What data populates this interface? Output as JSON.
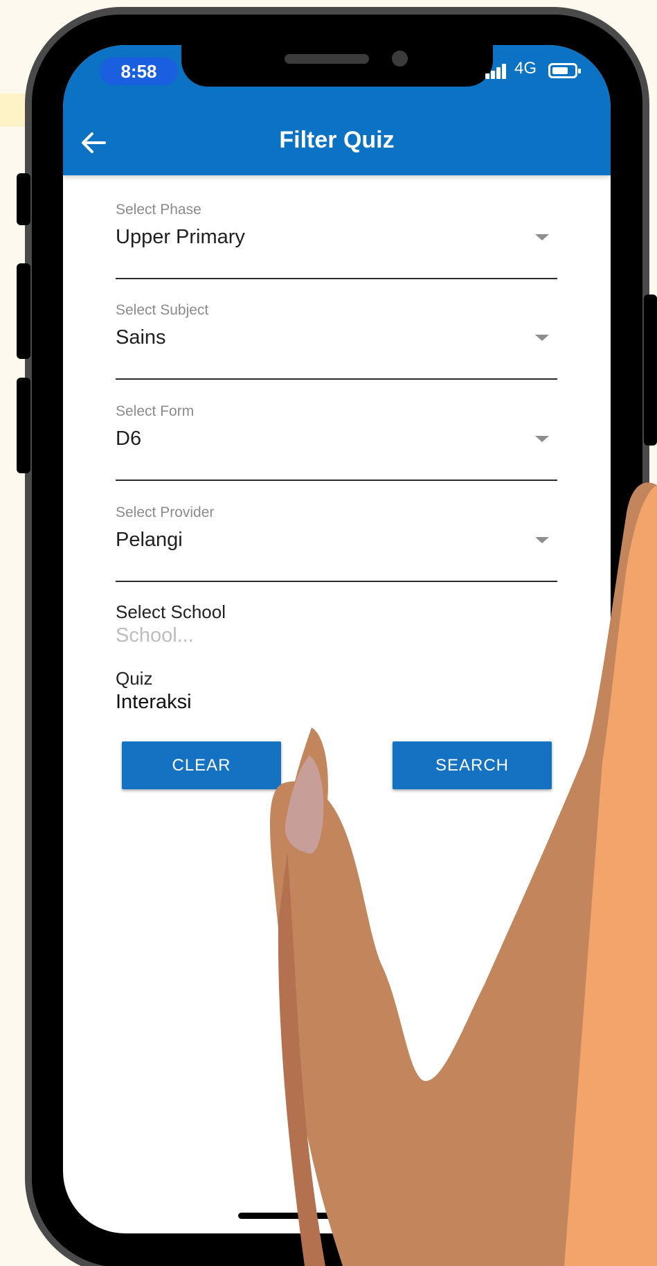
{
  "status_bar": {
    "time": "8:58",
    "network": "4G",
    "icons": [
      "signal-icon",
      "battery-icon"
    ]
  },
  "header": {
    "title": "Filter Quiz",
    "back_icon": "arrow-left-icon",
    "color": "#0b72c4"
  },
  "form": {
    "phase": {
      "label": "Select Phase",
      "value": "Upper Primary"
    },
    "subject": {
      "label": "Select Subject",
      "value": "Sains"
    },
    "form_level": {
      "label": "Select Form",
      "value": "D6"
    },
    "provider": {
      "label": "Select Provider",
      "value": "Pelangi"
    },
    "school": {
      "label": "Select School",
      "placeholder": "School..."
    },
    "quiz": {
      "label": "Quiz",
      "value": "Interaksi"
    }
  },
  "actions": {
    "clear_label": "CLEAR",
    "search_label": "SEARCH",
    "color": "#1571c2"
  }
}
